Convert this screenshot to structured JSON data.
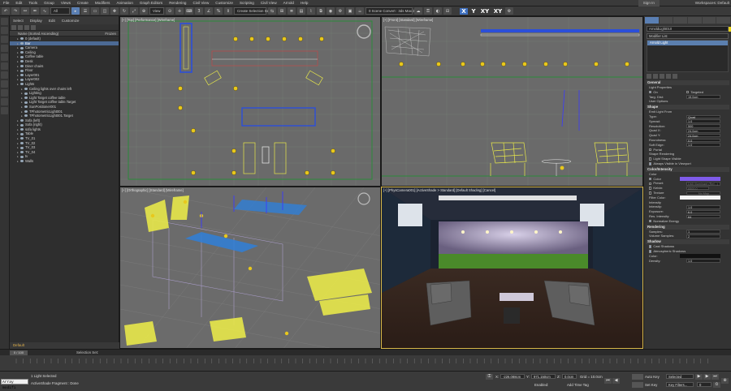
{
  "menu": [
    "File",
    "Edit",
    "Tools",
    "Group",
    "Views",
    "Create",
    "Modifiers",
    "Animation",
    "Graph Editors",
    "Rendering",
    "Civil View",
    "Customize",
    "Scripting",
    "Civil View",
    "Arnold",
    "Help"
  ],
  "signin": "Sign In",
  "workspace": "Workspaces: Default",
  "toolbar": {
    "filter": "All",
    "view": "View",
    "selection_set": "Create Selection Set",
    "axes": [
      "X",
      "Y",
      "XY",
      "XY"
    ]
  },
  "explorer": {
    "tabs": [
      "Select",
      "Display",
      "Edit",
      "Customize"
    ],
    "header": "Name (Sorted Ascending)",
    "header_right": "Frozen",
    "rows": [
      {
        "label": "0 (default)",
        "depth": 1,
        "sel": false
      },
      {
        "label": "Bar",
        "depth": 1,
        "sel": true
      },
      {
        "label": "Camera",
        "depth": 1,
        "sel": false
      },
      {
        "label": "Ceiling",
        "depth": 1,
        "sel": false
      },
      {
        "label": "Coffee table",
        "depth": 1,
        "sel": false
      },
      {
        "label": "Desk",
        "depth": 1,
        "sel": false
      },
      {
        "label": "Diner chairs",
        "depth": 1,
        "sel": false
      },
      {
        "label": "Floor",
        "depth": 1,
        "sel": false
      },
      {
        "label": "Layer001",
        "depth": 1,
        "sel": false
      },
      {
        "label": "Layer002",
        "depth": 1,
        "sel": false
      },
      {
        "label": "Lights",
        "depth": 1,
        "sel": false
      },
      {
        "label": "Ceiling lights over chairs left",
        "depth": 2,
        "sel": false
      },
      {
        "label": "Lighting",
        "depth": 2,
        "sel": false
      },
      {
        "label": "Light Target coffee table",
        "depth": 2,
        "sel": false
      },
      {
        "label": "Light Target coffee table.Target",
        "depth": 2,
        "sel": false
      },
      {
        "label": "SunPositioner001",
        "depth": 2,
        "sel": false
      },
      {
        "label": "TPhotometricLight001",
        "depth": 2,
        "sel": false
      },
      {
        "label": "TPhotometricLight001.Target",
        "depth": 2,
        "sel": false
      },
      {
        "label": "Sofa (left)",
        "depth": 1,
        "sel": false
      },
      {
        "label": "Sofa (right)",
        "depth": 1,
        "sel": false
      },
      {
        "label": "sofa lights",
        "depth": 1,
        "sel": false
      },
      {
        "label": "Table",
        "depth": 1,
        "sel": false
      },
      {
        "label": "TV_01",
        "depth": 1,
        "sel": false
      },
      {
        "label": "TV_02",
        "depth": 1,
        "sel": false
      },
      {
        "label": "TV_03",
        "depth": 1,
        "sel": false
      },
      {
        "label": "TV_04",
        "depth": 1,
        "sel": false
      },
      {
        "label": "tv",
        "depth": 1,
        "sel": false
      },
      {
        "label": "Walls",
        "depth": 1,
        "sel": false
      }
    ],
    "status": "Default"
  },
  "viewports": {
    "top": "[+] [Top] [Performance] [Wireframe]",
    "front": "[+] [Front] [Standard] [Wireframe]",
    "persp": "[+] [Orthographic] [Standard] [Wireframe]",
    "camera": "[+] [PhysCamera001] [ActiveShade > Standard] [Default Shading] [Cancel]"
  },
  "camera_menu": "0 Scene Convert : 3ds Max 2023",
  "cmd": {
    "object_name": "ArnoldLight010",
    "modifier_list": "Modifier List",
    "stack_item": "Arnold Light",
    "general": {
      "title": "General",
      "props": "Light Properties",
      "on": "On",
      "targeted": "Targeted",
      "targ_dist_label": "Targ. Dist:",
      "targ_dist": "15.0cm",
      "user_options": "User Options"
    },
    "shape": {
      "title": "Shape",
      "emit": "Emit Light From",
      "rows": [
        {
          "label": "Type:",
          "value": "Quad"
        },
        {
          "label": "Spread:",
          "value": "1.0"
        },
        {
          "label": "Resolution:",
          "value": "500"
        },
        {
          "label": "Quad X:",
          "value": "24.0cm"
        },
        {
          "label": "Quad Y:",
          "value": "24.0cm"
        },
        {
          "label": "Roundness:",
          "value": "0.0"
        },
        {
          "label": "Soft Edge:",
          "value": "1.0"
        }
      ],
      "portal": "Portal",
      "shape_rendering": "Shape Rendering",
      "light_visible": "Light Shape Visible",
      "always_visible": "Always Visible in Viewport"
    },
    "color": {
      "title": "Color/Intensity",
      "label": "Color",
      "color_opt": "Color",
      "preset": "Preset:",
      "preset_val": "D65 Illuminant (Ref...)",
      "kelvin": "Kelvin:",
      "kelvin_val": "6500.0",
      "texture": "Texture",
      "texture_val": "No Map",
      "filter": "Filter Color:",
      "intensity": "Intensity",
      "rows": [
        {
          "label": "Intensity:",
          "value": "1.0"
        },
        {
          "label": "Exposure:",
          "value": "6.0"
        },
        {
          "label": "Res. Intensity:",
          "value": "64"
        }
      ],
      "normalize": "Normalize Energy",
      "accent": "#7f5bea"
    },
    "rendering": {
      "title": "Rendering",
      "rows": [
        {
          "label": "Samples:",
          "value": "1"
        },
        {
          "label": "Volume Samples:",
          "value": "2"
        }
      ]
    },
    "shadow": {
      "title": "Shadow",
      "cast": "Cast Shadows",
      "atmos": "Atmospheric Shadows",
      "color_label": "Color:",
      "density_label": "Density:",
      "density": "1.0"
    }
  },
  "timeline": {
    "frame": "0 / 100",
    "selection_set": "Selection Set:"
  },
  "status": {
    "maxscript": "Array modifi",
    "selected": "1 Light Selected",
    "prompt": "ActiveShade Fragment : Done",
    "x": "-226.088cm",
    "y": "971.150cm",
    "z": "0.0cm",
    "grid": "Grid = 10.0cm",
    "enabled": "Enabled:",
    "add_tag": "Add Time Tag",
    "autokey": "Auto Key",
    "selected_drop": "Selected",
    "setkey": "Set Key",
    "key_filters": "Key Filters...",
    "frame_num": "0"
  }
}
